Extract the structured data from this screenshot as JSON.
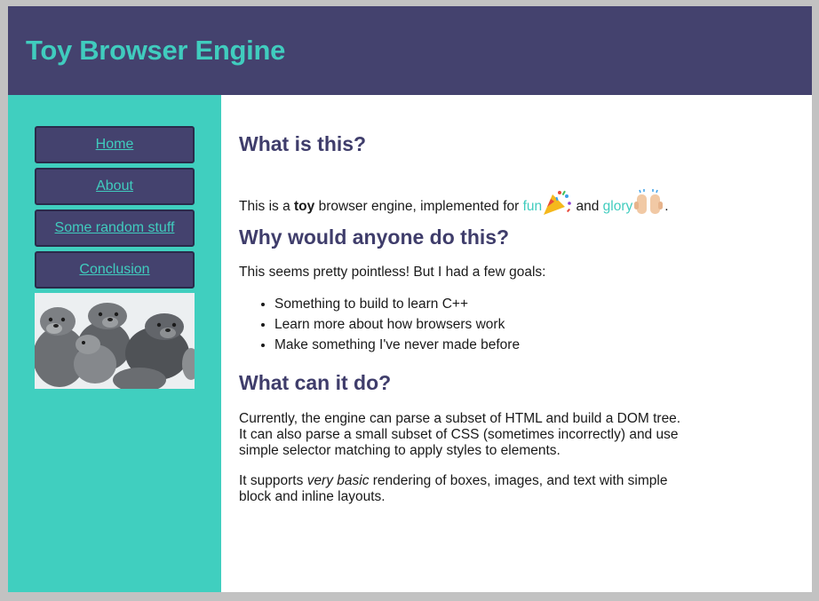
{
  "header": {
    "title": "Toy Browser Engine"
  },
  "nav": {
    "items": [
      {
        "label": "Home"
      },
      {
        "label": "About"
      },
      {
        "label": "Some random stuff"
      },
      {
        "label": "Conclusion"
      }
    ]
  },
  "content": {
    "section1": {
      "heading": "What is this?",
      "text_before": "This is a ",
      "bold": "toy",
      "text_mid": " browser engine, implemented for ",
      "link_fun": "fun",
      "text_and": " and ",
      "link_glory": "glory",
      "text_end": "."
    },
    "section2": {
      "heading": "Why would anyone do this?",
      "intro": "This seems pretty pointless! But I had a few goals:",
      "goals": [
        "Something to build to learn C++",
        "Learn more about how browsers work",
        "Make something I've never made before"
      ]
    },
    "section3": {
      "heading": "What can it do?",
      "para1": "Currently, the engine can parse a subset of HTML and build a DOM tree. It can also parse a small subset of CSS (sometimes incorrectly) and use simple selector matching to apply styles to elements.",
      "para2_before": "It supports ",
      "para2_em": "very basic",
      "para2_after": " rendering of boxes, images, and text with simple block and inline layouts."
    }
  },
  "icons": {
    "party": "party-popper-icon",
    "hands": "raising-hands-icon"
  },
  "colors": {
    "header_bg": "#44426e",
    "accent": "#40ccbe",
    "heading": "#3f3d6b"
  }
}
